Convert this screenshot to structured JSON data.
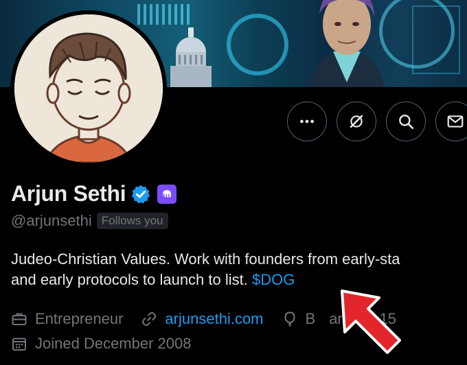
{
  "profile": {
    "name": "Arjun Sethi",
    "handle": "@arjunsethi",
    "follows_badge": "Follows you",
    "bio_text": "Judeo-Christian Values. Work with founders from early-sta",
    "bio_line2": "and early protocols to launch to list. ",
    "bio_cashtag": "$DOG"
  },
  "meta": {
    "occupation": "Entrepreneur",
    "website": "arjunsethi.com",
    "birthday": "Born January 15",
    "birthday_visible": "B",
    "birthday_tail": "anuary 15",
    "joined": "Joined December 2008"
  },
  "icons": {
    "more": "more-icon",
    "grok": "grok-icon",
    "search": "search-icon",
    "message": "message-icon",
    "verified": "verified-badge-icon",
    "affiliate": "kraken-affiliate-icon",
    "briefcase": "briefcase-icon",
    "link": "link-icon",
    "balloon": "balloon-icon",
    "calendar": "calendar-icon"
  },
  "colors": {
    "accent": "#1d9bf0",
    "secondary_text": "#71767b",
    "affiliate": "#7c4dff",
    "annotation_arrow": "#e3262b"
  }
}
